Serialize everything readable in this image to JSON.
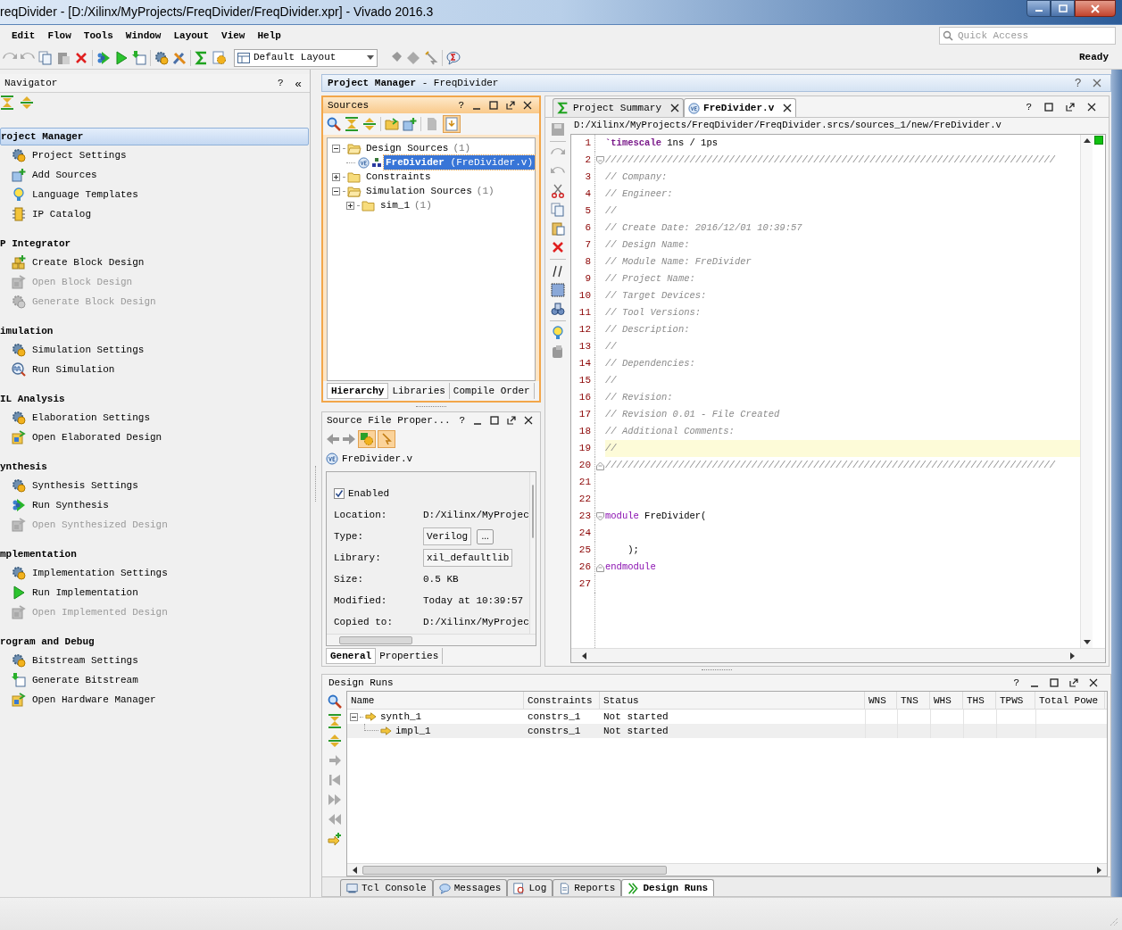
{
  "window": {
    "title": "reqDivider - [D:/Xilinx/MyProjects/FreqDivider/FreqDivider.xpr] - Vivado 2016.3"
  },
  "menu": [
    {
      "label": "Edit"
    },
    {
      "label": "Flow"
    },
    {
      "label": "Tools"
    },
    {
      "label": "Window"
    },
    {
      "label": "Layout"
    },
    {
      "label": "View"
    },
    {
      "label": "Help"
    }
  ],
  "quick_access": {
    "placeholder": "Quick Access"
  },
  "toolbar": {
    "layout": "Default Layout",
    "status": "Ready"
  },
  "navigator": {
    "title": "Navigator",
    "help": "?",
    "collapse": "«",
    "sections": [
      {
        "title": "roject Manager",
        "selected": true,
        "items": [
          {
            "label": "Project Settings",
            "kind": "gear",
            "disabled": false
          },
          {
            "label": "Add Sources",
            "kind": "add",
            "disabled": false
          },
          {
            "label": "Language Templates",
            "kind": "bulb",
            "disabled": false
          },
          {
            "label": "IP Catalog",
            "kind": "chip",
            "disabled": false
          }
        ]
      },
      {
        "title": "P Integrator",
        "selected": false,
        "items": [
          {
            "label": "Create Block Design",
            "kind": "blocks",
            "disabled": false
          },
          {
            "label": "Open Block Design",
            "kind": "open",
            "disabled": true
          },
          {
            "label": "Generate Block Design",
            "kind": "gear",
            "disabled": true
          }
        ]
      },
      {
        "title": "imulation",
        "selected": false,
        "items": [
          {
            "label": "Simulation Settings",
            "kind": "gear",
            "disabled": false
          },
          {
            "label": "Run Simulation",
            "kind": "wave",
            "disabled": false
          }
        ]
      },
      {
        "title": "IL Analysis",
        "selected": false,
        "items": [
          {
            "label": "Elaboration Settings",
            "kind": "gear",
            "disabled": false
          },
          {
            "label": "Open Elaborated Design",
            "kind": "open",
            "disabled": false
          }
        ]
      },
      {
        "title": "ynthesis",
        "selected": false,
        "items": [
          {
            "label": "Synthesis Settings",
            "kind": "gear",
            "disabled": false
          },
          {
            "label": "Run Synthesis",
            "kind": "run",
            "disabled": false
          },
          {
            "label": "Open Synthesized Design",
            "kind": "open",
            "disabled": true
          }
        ]
      },
      {
        "title": "mplementation",
        "selected": false,
        "items": [
          {
            "label": "Implementation Settings",
            "kind": "gear",
            "disabled": false
          },
          {
            "label": "Run Implementation",
            "kind": "play",
            "disabled": false
          },
          {
            "label": "Open Implemented Design",
            "kind": "open",
            "disabled": true
          }
        ]
      },
      {
        "title": "rogram and Debug",
        "selected": false,
        "items": [
          {
            "label": "Bitstream Settings",
            "kind": "gear",
            "disabled": false
          },
          {
            "label": "Generate Bitstream",
            "kind": "bitstream",
            "disabled": false
          },
          {
            "label": "Open Hardware Manager",
            "kind": "open",
            "disabled": false
          }
        ]
      }
    ]
  },
  "project_header": {
    "title": "**Project Manager** - FreqDivider",
    "help": "?"
  },
  "sources": {
    "title": "Sources",
    "help": "?",
    "tree": [
      {
        "kind": "folder",
        "label": "Design Sources",
        "count": "(1)",
        "expanded": true,
        "selected": false,
        "children": [
          {
            "kind": "module",
            "label": "**FreDivider** (FreDivider.v)",
            "selected": true
          }
        ]
      },
      {
        "kind": "folder",
        "label": "Constraints",
        "expanded": false,
        "selected": false
      },
      {
        "kind": "folder",
        "label": "Simulation Sources",
        "count": "(1)",
        "expanded": true,
        "selected": false,
        "children": [
          {
            "kind": "folder",
            "label": "sim_1",
            "count": "(1)",
            "expanded": false,
            "selected": false
          }
        ]
      }
    ],
    "tabs": [
      {
        "label": "Hierarchy",
        "selected": true
      },
      {
        "label": "Libraries",
        "selected": false
      },
      {
        "label": "Compile Order",
        "selected": false
      }
    ]
  },
  "properties": {
    "title": "Source File Proper...",
    "help": "?",
    "file": "FreDivider.v",
    "enabled": {
      "label": "Enabled",
      "checked": true
    },
    "fields": [
      {
        "label": "Location:",
        "value": "D:/Xilinx/MyProjec",
        "kind": "text"
      },
      {
        "label": "Type:",
        "value": "Verilog",
        "kind": "field",
        "button": "..."
      },
      {
        "label": "Library:",
        "value": "xil_defaultlib",
        "kind": "field"
      },
      {
        "label": "Size:",
        "value": "0.5 KB",
        "kind": "text"
      },
      {
        "label": "Modified:",
        "value": "Today at 10:39:57",
        "kind": "text"
      },
      {
        "label": "Copied to:",
        "value": "D:/Xilinx/MyProjec",
        "kind": "text"
      }
    ],
    "tabs": [
      {
        "label": "General",
        "selected": true
      },
      {
        "label": "Properties",
        "selected": false
      }
    ]
  },
  "editor": {
    "help": "?",
    "tabs": [
      {
        "label": "Project Summary",
        "kind": "summary",
        "selected": false
      },
      {
        "label": "FreDivider.v",
        "kind": "verilog",
        "selected": true
      }
    ],
    "path": "D:/Xilinx/MyProjects/FreqDivider/FreqDivider.srcs/sources_1/new/FreDivider.v",
    "lines": [
      {
        "number": "1",
        "segments": [
          {
            "text": "`timescale",
            "kind": "directive"
          },
          {
            "text": " 1ns / 1ps",
            "kind": "plain"
          }
        ]
      },
      {
        "number": "2",
        "fold_start": true,
        "segments": [
          {
            "text": "////////////////////////////////////////////////////////////////////////////////",
            "kind": "comment"
          }
        ]
      },
      {
        "number": "3",
        "segments": [
          {
            "text": "// Company:",
            "kind": "comment"
          }
        ]
      },
      {
        "number": "4",
        "segments": [
          {
            "text": "// Engineer:",
            "kind": "comment"
          }
        ]
      },
      {
        "number": "5",
        "segments": [
          {
            "text": "//",
            "kind": "comment"
          }
        ]
      },
      {
        "number": "6",
        "segments": [
          {
            "text": "// Create Date: 2016/12/01 10:39:57",
            "kind": "comment"
          }
        ]
      },
      {
        "number": "7",
        "segments": [
          {
            "text": "// Design Name:",
            "kind": "comment"
          }
        ]
      },
      {
        "number": "8",
        "segments": [
          {
            "text": "// Module Name: FreDivider",
            "kind": "comment"
          }
        ]
      },
      {
        "number": "9",
        "segments": [
          {
            "text": "// Project Name:",
            "kind": "comment"
          }
        ]
      },
      {
        "number": "10",
        "segments": [
          {
            "text": "// Target Devices:",
            "kind": "comment"
          }
        ]
      },
      {
        "number": "11",
        "segments": [
          {
            "text": "// Tool Versions:",
            "kind": "comment"
          }
        ]
      },
      {
        "number": "12",
        "segments": [
          {
            "text": "// Description:",
            "kind": "comment"
          }
        ]
      },
      {
        "number": "13",
        "segments": [
          {
            "text": "//",
            "kind": "comment"
          }
        ]
      },
      {
        "number": "14",
        "segments": [
          {
            "text": "// Dependencies:",
            "kind": "comment"
          }
        ]
      },
      {
        "number": "15",
        "segments": [
          {
            "text": "//",
            "kind": "comment"
          }
        ]
      },
      {
        "number": "16",
        "segments": [
          {
            "text": "// Revision:",
            "kind": "comment"
          }
        ]
      },
      {
        "number": "17",
        "segments": [
          {
            "text": "// Revision 0.01 - File Created",
            "kind": "comment"
          }
        ]
      },
      {
        "number": "18",
        "segments": [
          {
            "text": "// Additional Comments:",
            "kind": "comment"
          }
        ]
      },
      {
        "number": "19",
        "highlighted": true,
        "segments": [
          {
            "text": "//",
            "kind": "comment"
          }
        ]
      },
      {
        "number": "20",
        "fold_end": true,
        "segments": [
          {
            "text": "////////////////////////////////////////////////////////////////////////////////",
            "kind": "comment"
          }
        ]
      },
      {
        "number": "21"
      },
      {
        "number": "22"
      },
      {
        "number": "23",
        "fold_start": true,
        "segments": [
          {
            "text": "module",
            "kind": "keyword"
          },
          {
            "text": " FreDivider(",
            "kind": "plain"
          }
        ]
      },
      {
        "number": "24"
      },
      {
        "number": "25",
        "segments": [
          {
            "text": "    );",
            "kind": "plain"
          }
        ]
      },
      {
        "number": "26",
        "fold_end": true,
        "segments": [
          {
            "text": "endmodule",
            "kind": "keyword"
          }
        ]
      },
      {
        "number": "27"
      }
    ]
  },
  "design_runs": {
    "title": "Design Runs",
    "help": "?",
    "columns": [
      "Name",
      "Constraints",
      "Status",
      "WNS",
      "TNS",
      "WHS",
      "THS",
      "TPWS",
      "Total Powe"
    ],
    "rows": [
      {
        "name": "synth_1",
        "constraints": "constrs_1",
        "status": "Not started",
        "expanded": true,
        "children": [
          {
            "name": "impl_1",
            "constraints": "constrs_1",
            "status": "Not started"
          }
        ]
      }
    ],
    "tabs": [
      {
        "label": "Tcl Console",
        "kind": "console",
        "selected": false
      },
      {
        "label": "Messages",
        "kind": "messages",
        "selected": false
      },
      {
        "label": "Log",
        "kind": "log",
        "selected": false
      },
      {
        "label": "Reports",
        "kind": "reports",
        "selected": false
      },
      {
        "label": "Design Runs",
        "kind": "runs",
        "selected": true
      }
    ]
  }
}
